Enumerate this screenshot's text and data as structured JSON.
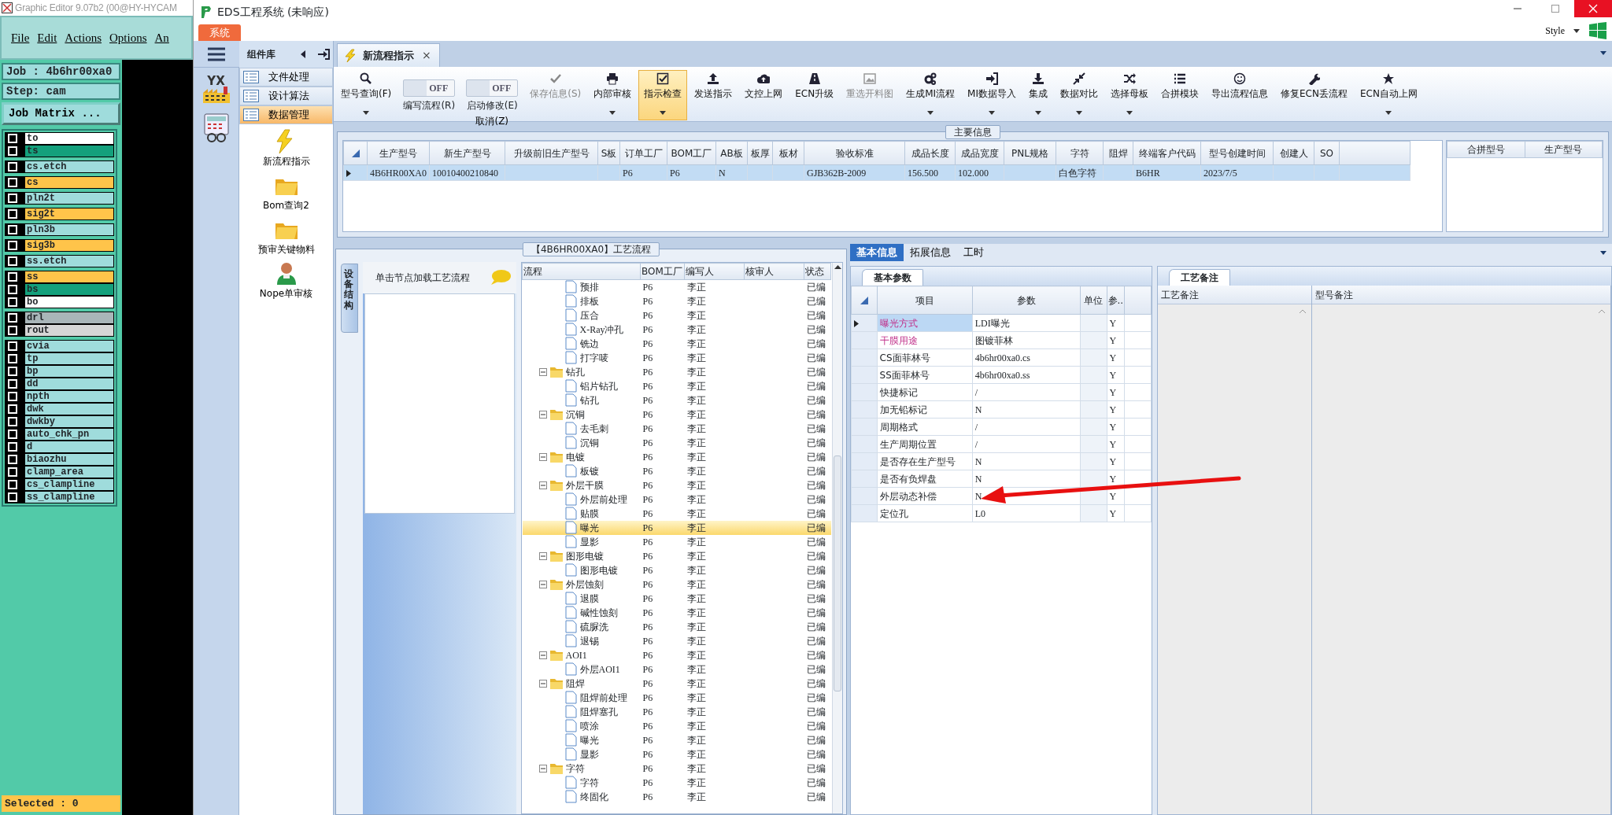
{
  "editor": {
    "title": "Graphic Editor 9.07b2 (00@HY-HYCAM",
    "menu": [
      "File",
      "Edit",
      "Actions",
      "Options",
      "An"
    ],
    "job": "Job : 4b6hr00xa0",
    "step": "Step: cam",
    "matrix_button": "Job Matrix ...",
    "layer_groups": [
      [
        {
          "name": "to",
          "color": "#ffffff",
          "checked": false
        },
        {
          "name": "ts",
          "color": "#14a07c",
          "checked": false
        }
      ],
      [
        {
          "name": "cs.etch",
          "color": "#9fdcdc",
          "checked": false
        }
      ],
      [
        {
          "name": "cs",
          "color": "#ffc44a",
          "checked": false
        }
      ],
      [
        {
          "name": "pln2t",
          "color": "#9fdcdc",
          "checked": false
        }
      ],
      [
        {
          "name": "sig2t",
          "color": "#ffc44a",
          "checked": false
        }
      ],
      [
        {
          "name": "pln3b",
          "color": "#9fdcdc",
          "checked": false
        }
      ],
      [
        {
          "name": "sig3b",
          "color": "#ffc44a",
          "checked": false
        }
      ],
      [
        {
          "name": "ss.etch",
          "color": "#9fdcdc",
          "checked": false
        }
      ],
      [
        {
          "name": "ss",
          "color": "#ffc44a",
          "checked": false
        },
        {
          "name": "bs",
          "color": "#14a07c",
          "checked": false
        },
        {
          "name": "bo",
          "color": "#ffffff",
          "checked": false
        }
      ],
      [
        {
          "name": "drl",
          "color": "#a9b6b9",
          "checked": false
        },
        {
          "name": "rout",
          "color": "#d6d6d6",
          "checked": false
        }
      ],
      [
        {
          "name": "cvia",
          "color": "#9fdcdc",
          "checked": false
        },
        {
          "name": "tp",
          "color": "#9fdcdc",
          "checked": false
        },
        {
          "name": "bp",
          "color": "#9fdcdc",
          "checked": false
        },
        {
          "name": "dd",
          "color": "#9fdcdc",
          "checked": false
        },
        {
          "name": "npth",
          "color": "#9fdcdc",
          "checked": false
        },
        {
          "name": "dwk",
          "color": "#9fdcdc",
          "checked": false
        },
        {
          "name": "dwkby",
          "color": "#9fdcdc",
          "checked": false
        },
        {
          "name": "auto_chk_pn",
          "color": "#9fdcdc",
          "checked": false
        },
        {
          "name": "d",
          "color": "#9fdcdc",
          "checked": false
        },
        {
          "name": "biaozhu",
          "color": "#9fdcdc",
          "checked": false
        },
        {
          "name": "clamp_area",
          "color": "#9fdcdc",
          "checked": false
        },
        {
          "name": "cs_clampline",
          "color": "#9fdcdc",
          "checked": false
        },
        {
          "name": "ss_clampline",
          "color": "#9fdcdc",
          "checked": false
        }
      ]
    ],
    "status": "Selected : 0"
  },
  "window": {
    "title": "EDS工程系统 (未响应)",
    "system_tab": "系统",
    "style_menu": "Style"
  },
  "nav": {
    "logo_text": "YX"
  },
  "sidebar": {
    "title": "组件库",
    "categories": [
      {
        "label": "文件处理",
        "selected": false
      },
      {
        "label": "设计算法",
        "selected": false
      },
      {
        "label": "数据管理",
        "selected": true
      }
    ],
    "tools": [
      "新流程指示",
      "Bom查询2",
      "预审关键物料",
      "Nope单审核"
    ]
  },
  "doc_tab": {
    "label": "新流程指示",
    "close": "×"
  },
  "toolbar": [
    {
      "kind": "button",
      "label": "型号查询(F)",
      "dropdown": true,
      "disabled": false,
      "selected": false
    },
    {
      "kind": "toggle",
      "label": "编写流程(R)",
      "value": "OFF",
      "on": false
    },
    {
      "kind": "toggle",
      "label": "启动修改(E)",
      "value": "OFF",
      "on": false,
      "extra": "取消(Z)"
    },
    {
      "kind": "button",
      "label": "保存信息(S)",
      "dropdown": false,
      "disabled": true,
      "selected": false
    },
    {
      "kind": "button",
      "label": "内部审核",
      "dropdown": true,
      "disabled": false,
      "selected": false
    },
    {
      "kind": "button",
      "label": "指示检查",
      "dropdown": true,
      "disabled": false,
      "selected": true
    },
    {
      "kind": "button",
      "label": "发送指示",
      "dropdown": false,
      "disabled": false,
      "selected": false
    },
    {
      "kind": "button",
      "label": "文控上网",
      "dropdown": false,
      "disabled": false,
      "selected": false
    },
    {
      "kind": "button",
      "label": "ECN升级",
      "dropdown": false,
      "disabled": false,
      "selected": false
    },
    {
      "kind": "button",
      "label": "重选开料图",
      "dropdown": false,
      "disabled": true,
      "selected": false
    },
    {
      "kind": "button",
      "label": "生成MI流程",
      "dropdown": true,
      "disabled": false,
      "selected": false
    },
    {
      "kind": "button",
      "label": "MI数据导入",
      "dropdown": true,
      "disabled": false,
      "selected": false
    },
    {
      "kind": "button",
      "label": "集成",
      "dropdown": true,
      "disabled": false,
      "selected": false
    },
    {
      "kind": "button",
      "label": "数据对比",
      "dropdown": true,
      "disabled": false,
      "selected": false
    },
    {
      "kind": "button",
      "label": "选择母板",
      "dropdown": true,
      "disabled": false,
      "selected": false
    },
    {
      "kind": "button",
      "label": "合拼模块",
      "dropdown": false,
      "disabled": false,
      "selected": false
    },
    {
      "kind": "button",
      "label": "导出流程信息",
      "dropdown": false,
      "disabled": false,
      "selected": false
    },
    {
      "kind": "button",
      "label": "修复ECN丢流程",
      "dropdown": false,
      "disabled": false,
      "selected": false
    },
    {
      "kind": "button",
      "label": "ECN自动上网",
      "dropdown": true,
      "disabled": false,
      "selected": false
    }
  ],
  "main_info": {
    "title": "主要信息",
    "columns": [
      "生产型号",
      "新生产型号",
      "升级前旧生产型号",
      "S板",
      "订单工厂",
      "BOM工厂",
      "AB板",
      "板厚",
      "板材",
      "验收标准",
      "成品长度",
      "成品宽度",
      "PNL规格",
      "字符",
      "阻焊",
      "终端客户代码",
      "型号创建时间",
      "创建人",
      "SO"
    ],
    "rows": [
      {
        "selected": true,
        "cells": [
          "4B6HR00XA0",
          "10010400210840",
          null,
          null,
          "P6",
          "P6",
          "N",
          null,
          null,
          "GJB362B-2009",
          "156.500",
          "102.000",
          null,
          "白色字符",
          null,
          "B6HR",
          "2023/7/5",
          null,
          null
        ]
      }
    ],
    "merge_columns": [
      "合拼型号",
      "生产型号"
    ]
  },
  "flow": {
    "title": "【4B6HR00XA0】工艺流程",
    "side_tab": "设备结构",
    "hint": "单击节点加载工艺流程",
    "columns": [
      "流程",
      "BOM工厂",
      "编写人",
      "核审人",
      "状态"
    ],
    "nodes": [
      {
        "children": [
          {
            "label": "预排",
            "bom": "P6",
            "writer": "李正",
            "status": "已编",
            "selected": false
          },
          {
            "label": "排板",
            "bom": "P6",
            "writer": "李正",
            "status": "已编",
            "selected": false
          },
          {
            "label": "压合",
            "bom": "P6",
            "writer": "李正",
            "status": "已编",
            "selected": false
          },
          {
            "label": "X-Ray冲孔",
            "bom": "P6",
            "writer": "李正",
            "status": "已编",
            "selected": false
          },
          {
            "label": "铣边",
            "bom": "P6",
            "writer": "李正",
            "status": "已编",
            "selected": false
          },
          {
            "label": "打字唛",
            "bom": "P6",
            "writer": "李正",
            "status": "已编",
            "selected": false
          }
        ]
      },
      {
        "label": "钻孔",
        "bom": "P6",
        "writer": "李正",
        "status": "已编",
        "selected": false,
        "expanded": true,
        "children": [
          {
            "label": "铝片钻孔",
            "bom": "P6",
            "writer": "李正",
            "status": "已编",
            "selected": false
          },
          {
            "label": "钻孔",
            "bom": "P6",
            "writer": "李正",
            "status": "已编",
            "selected": false
          }
        ]
      },
      {
        "label": "沉铜",
        "bom": "P6",
        "writer": "李正",
        "status": "已编",
        "selected": false,
        "expanded": true,
        "children": [
          {
            "label": "去毛刺",
            "bom": "P6",
            "writer": "李正",
            "status": "已编",
            "selected": false
          },
          {
            "label": "沉铜",
            "bom": "P6",
            "writer": "李正",
            "status": "已编",
            "selected": false
          }
        ]
      },
      {
        "label": "电镀",
        "bom": "P6",
        "writer": "李正",
        "status": "已编",
        "selected": false,
        "expanded": true,
        "children": [
          {
            "label": "板镀",
            "bom": "P6",
            "writer": "李正",
            "status": "已编",
            "selected": false
          }
        ]
      },
      {
        "label": "外层干膜",
        "bom": "P6",
        "writer": "李正",
        "status": "已编",
        "selected": false,
        "expanded": true,
        "children": [
          {
            "label": "外层前处理",
            "bom": "P6",
            "writer": "李正",
            "status": "已编",
            "selected": false
          },
          {
            "label": "贴膜",
            "bom": "P6",
            "writer": "李正",
            "status": "已编",
            "selected": false
          },
          {
            "label": "曝光",
            "bom": "P6",
            "writer": "李正",
            "status": "已编",
            "selected": true
          },
          {
            "label": "显影",
            "bom": "P6",
            "writer": "李正",
            "status": "已编",
            "selected": false
          }
        ]
      },
      {
        "label": "图形电镀",
        "bom": "P6",
        "writer": "李正",
        "status": "已编",
        "selected": false,
        "expanded": true,
        "children": [
          {
            "label": "图形电镀",
            "bom": "P6",
            "writer": "李正",
            "status": "已编",
            "selected": false
          }
        ]
      },
      {
        "label": "外层蚀刻",
        "bom": "P6",
        "writer": "李正",
        "status": "已编",
        "selected": false,
        "expanded": true,
        "children": [
          {
            "label": "退膜",
            "bom": "P6",
            "writer": "李正",
            "status": "已编",
            "selected": false
          },
          {
            "label": "碱性蚀刻",
            "bom": "P6",
            "writer": "李正",
            "status": "已编",
            "selected": false
          },
          {
            "label": "硫脲洗",
            "bom": "P6",
            "writer": "李正",
            "status": "已编",
            "selected": false
          },
          {
            "label": "退锡",
            "bom": "P6",
            "writer": "李正",
            "status": "已编",
            "selected": false
          }
        ]
      },
      {
        "label": "AOI1",
        "bom": "P6",
        "writer": "李正",
        "status": "已编",
        "selected": false,
        "expanded": true,
        "children": [
          {
            "label": "外层AOI1",
            "bom": "P6",
            "writer": "李正",
            "status": "已编",
            "selected": false
          }
        ]
      },
      {
        "label": "阻焊",
        "bom": "P6",
        "writer": "李正",
        "status": "已编",
        "selected": false,
        "expanded": true,
        "children": [
          {
            "label": "阻焊前处理",
            "bom": "P6",
            "writer": "李正",
            "status": "已编",
            "selected": false
          },
          {
            "label": "阻焊塞孔",
            "bom": "P6",
            "writer": "李正",
            "status": "已编",
            "selected": false
          },
          {
            "label": "喷涂",
            "bom": "P6",
            "writer": "李正",
            "status": "已编",
            "selected": false
          },
          {
            "label": "曝光",
            "bom": "P6",
            "writer": "李正",
            "status": "已编",
            "selected": false
          },
          {
            "label": "显影",
            "bom": "P6",
            "writer": "李正",
            "status": "已编",
            "selected": false
          }
        ]
      },
      {
        "label": "字符",
        "bom": "P6",
        "writer": "李正",
        "status": "已编",
        "selected": false,
        "expanded": true,
        "children": [
          {
            "label": "字符",
            "bom": "P6",
            "writer": "李正",
            "status": "已编",
            "selected": false
          },
          {
            "label": "终固化",
            "bom": "P6",
            "writer": "李正",
            "status": "已编",
            "selected": false
          }
        ]
      }
    ]
  },
  "detail": {
    "tabs": [
      {
        "label": "基本信息",
        "selected": true
      },
      {
        "label": "拓展信息",
        "selected": false
      },
      {
        "label": "工时",
        "selected": false
      }
    ],
    "params": {
      "tab": "基本参数",
      "columns": [
        "项目",
        "参数",
        "单位",
        "参.."
      ],
      "rows": [
        {
          "item": "曝光方式",
          "value": "LDI曝光",
          "flag": "Y",
          "required": true,
          "selected": true
        },
        {
          "item": "干膜用途",
          "value": "图镀菲林",
          "flag": "Y",
          "required": true,
          "selected": false
        },
        {
          "item": "CS面菲林号",
          "value": "4b6hr00xa0.cs",
          "flag": "Y",
          "required": false,
          "selected": false
        },
        {
          "item": "SS面菲林号",
          "value": "4b6hr00xa0.ss",
          "flag": "Y",
          "required": false,
          "selected": false
        },
        {
          "item": "快捷标记",
          "value": "/",
          "flag": "Y",
          "required": false,
          "selected": false
        },
        {
          "item": "加无铅标记",
          "value": "N",
          "flag": "Y",
          "required": false,
          "selected": false
        },
        {
          "item": "周期格式",
          "value": "/",
          "flag": "Y",
          "required": false,
          "selected": false
        },
        {
          "item": "生产周期位置",
          "value": "/",
          "flag": "Y",
          "required": false,
          "selected": false
        },
        {
          "item": "是否存在生产型号",
          "value": "N",
          "flag": "Y",
          "required": false,
          "selected": false
        },
        {
          "item": "是否有负焊盘",
          "value": "N",
          "flag": "Y",
          "required": false,
          "selected": false
        },
        {
          "item": "外层动态补偿",
          "value": "N",
          "flag": "Y",
          "required": false,
          "selected": false
        },
        {
          "item": "定位孔",
          "value": "L0",
          "flag": "Y",
          "required": false,
          "selected": false
        }
      ]
    },
    "remarks": {
      "tab": "工艺备注",
      "columns": [
        "工艺备注",
        "型号备注"
      ]
    }
  }
}
